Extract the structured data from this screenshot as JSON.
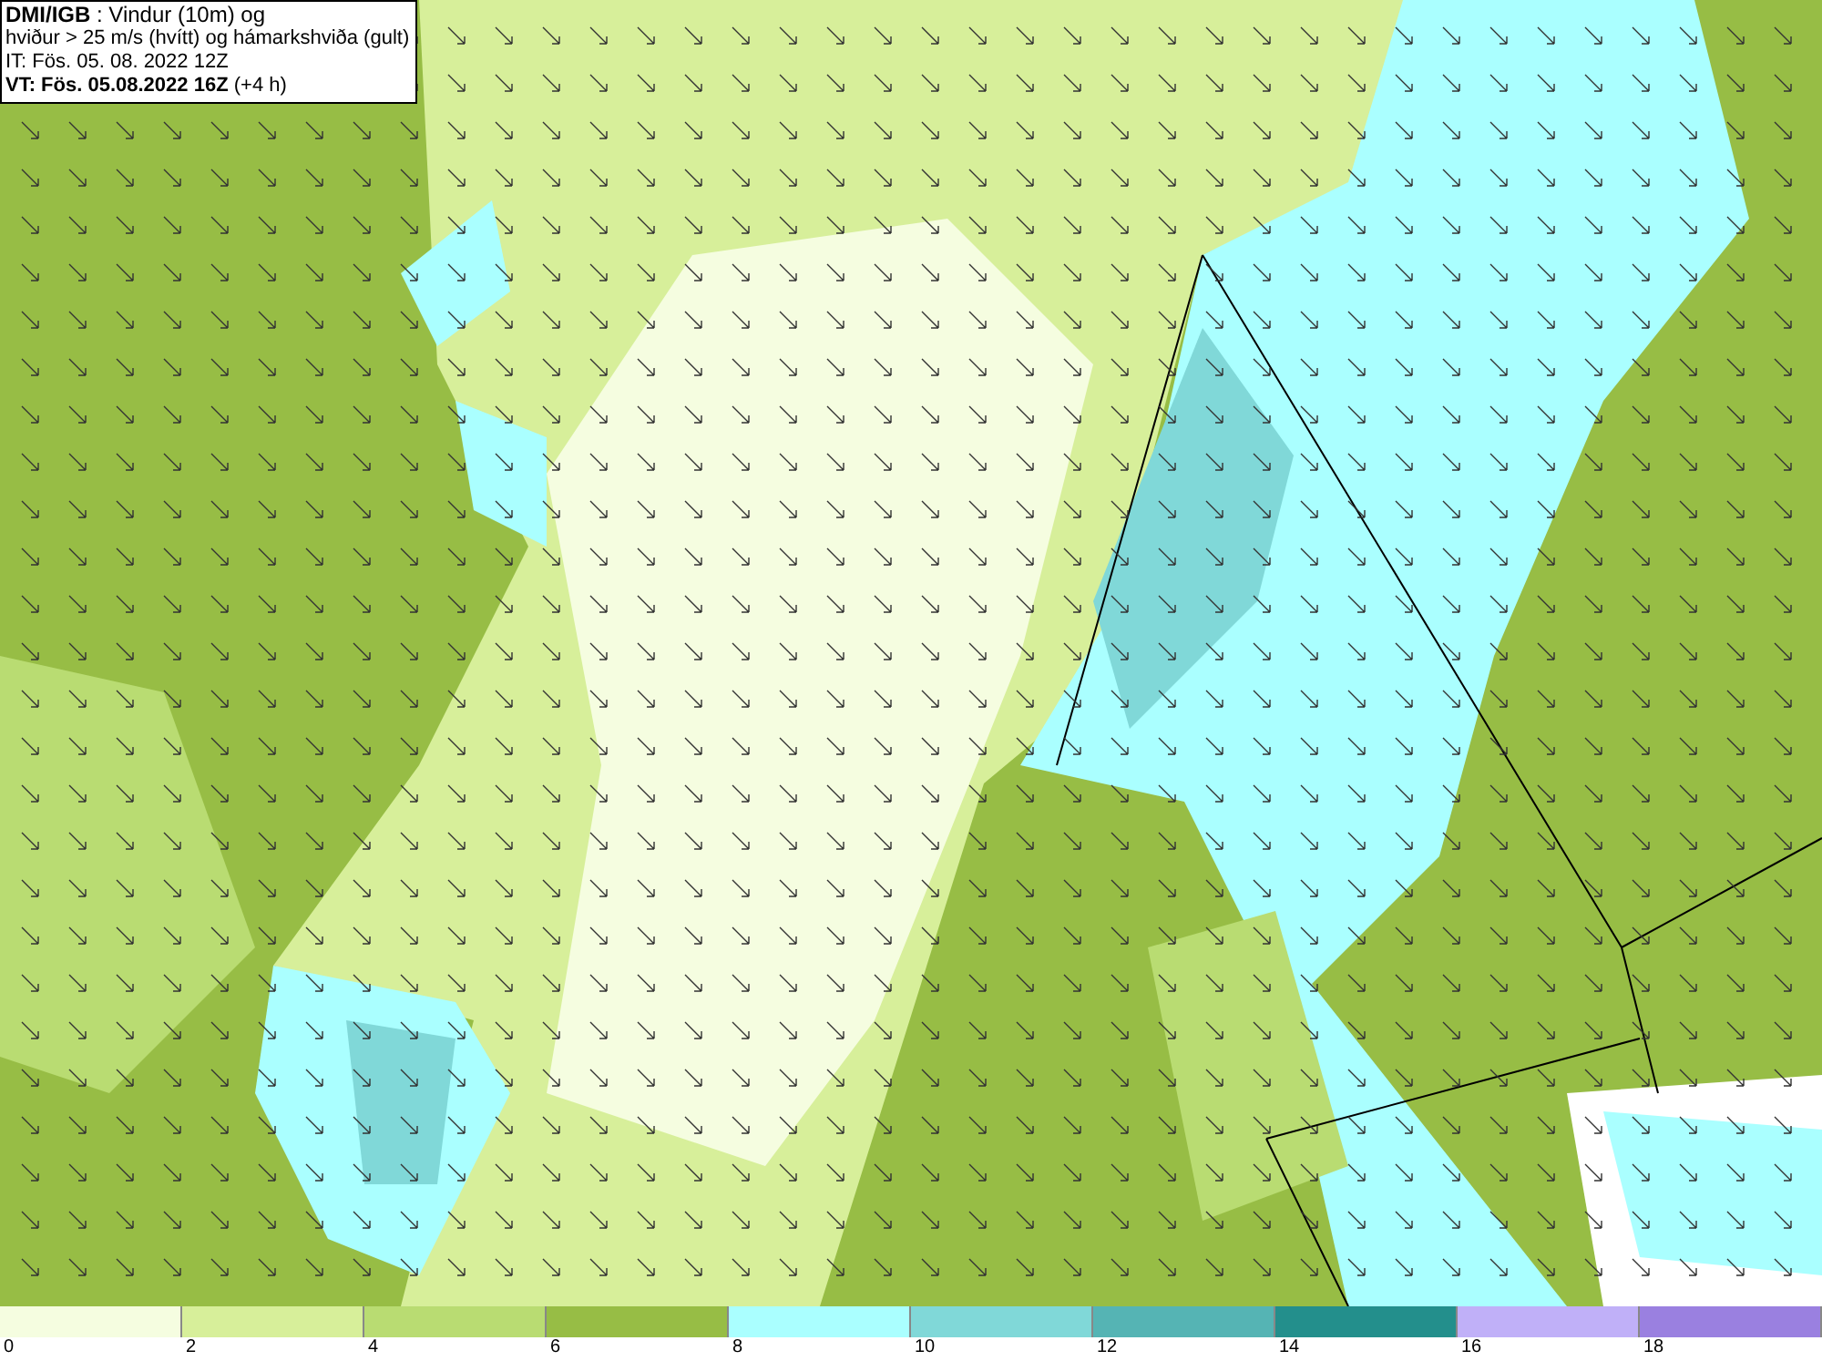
{
  "info_box": {
    "lines": [
      "**DMI/IGB** : Vindur (10m) og",
      "hviður > 25 m/s (hvítt) og hámarkshviða (gult)",
      "IT: Fös. 05. 08. 2022 12Z",
      "**VT: Fös. 05.08.2022 16Z** (+4 h)"
    ]
  },
  "legend": [
    {
      "color": "#f5fde0",
      "label": "0"
    },
    {
      "color": "#d7ef9a",
      "label": "2"
    },
    {
      "color": "#b9dc72",
      "label": "4"
    },
    {
      "color": "#97bd45",
      "label": "6"
    },
    {
      "color": "#aaffff",
      "label": "8"
    },
    {
      "color": "#80d8d8",
      "label": "10"
    },
    {
      "color": "#55b4b4",
      "label": "12"
    },
    {
      "color": "#238f8c",
      "label": "14"
    },
    {
      "color": "#c0b0f8",
      "label": "16"
    },
    {
      "color": "#9a80e0",
      "label": "18"
    }
  ]
}
